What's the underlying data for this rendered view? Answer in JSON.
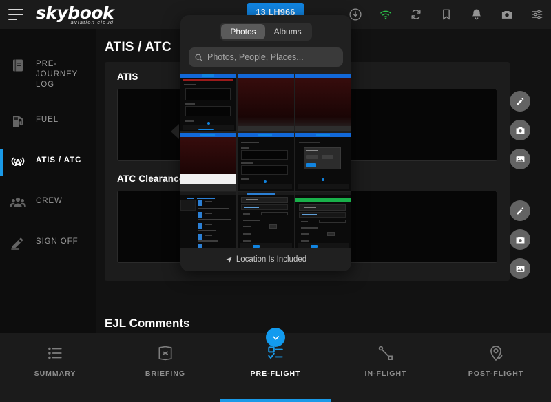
{
  "app": {
    "brand_name": "skybook",
    "brand_tagline": "aviation cloud",
    "flight_chip": "13 LH966"
  },
  "topbar": {
    "icons": [
      {
        "name": "menu-icon",
        "label": "Menu"
      },
      {
        "name": "download-icon",
        "label": "Download"
      },
      {
        "name": "wifi-icon",
        "label": "Connected",
        "color": "#2cc14a"
      },
      {
        "name": "sync-icon",
        "label": "Sync"
      },
      {
        "name": "bookmark-icon",
        "label": "Bookmark"
      },
      {
        "name": "bell-icon",
        "label": "Notifications"
      },
      {
        "name": "camera-icon",
        "label": "Camera"
      },
      {
        "name": "settings-sliders-icon",
        "label": "Settings"
      }
    ]
  },
  "sidebar": {
    "items": [
      {
        "label": "PRE-JOURNEY LOG",
        "icon": "book-icon",
        "active": false
      },
      {
        "label": "FUEL",
        "icon": "fuel-pump-icon",
        "active": false
      },
      {
        "label": "ATIS / ATC",
        "icon": "antenna-icon",
        "active": true
      },
      {
        "label": "CREW",
        "icon": "crew-people-icon",
        "active": false
      },
      {
        "label": "SIGN OFF",
        "icon": "sign-off-pen-icon",
        "active": false
      }
    ]
  },
  "main": {
    "page_title": "ATIS / ATC",
    "sections": [
      {
        "title": "ATIS",
        "value": ""
      },
      {
        "title": "ATC Clearance",
        "value": ""
      }
    ],
    "ejl_title": "EJL Comments",
    "action_buttons": [
      {
        "name": "edit-button",
        "icon": "pencil-icon"
      },
      {
        "name": "camera-button",
        "icon": "camera-icon"
      },
      {
        "name": "gallery-button",
        "icon": "image-icon"
      }
    ],
    "scroll_down_label": "Scroll down"
  },
  "photo_popover": {
    "tabs": [
      {
        "label": "Photos",
        "selected": true
      },
      {
        "label": "Albums",
        "selected": false
      }
    ],
    "search": {
      "placeholder": "Photos, People, Places...",
      "value": ""
    },
    "footer": "Location Is Included",
    "thumbnails": [
      {
        "name": "thumb-journey-log-form",
        "kind": "form-dark"
      },
      {
        "name": "thumb-dark-red-photo-1",
        "kind": "photo-red"
      },
      {
        "name": "thumb-dark-red-photo-2",
        "kind": "photo-red"
      },
      {
        "name": "thumb-dark-red-photo-3",
        "kind": "photo-red-white"
      },
      {
        "name": "thumb-atis-form",
        "kind": "form-dark"
      },
      {
        "name": "thumb-image-options-dialog",
        "kind": "dialog"
      },
      {
        "name": "thumb-file-list",
        "kind": "file-list"
      },
      {
        "name": "thumb-journey-log-blue",
        "kind": "journey-blue"
      },
      {
        "name": "thumb-journey-log-green",
        "kind": "journey-green"
      }
    ]
  },
  "bottom_nav": {
    "items": [
      {
        "label": "SUMMARY",
        "icon": "list-icon",
        "active": false
      },
      {
        "label": "BRIEFING",
        "icon": "briefing-doc-icon",
        "active": false
      },
      {
        "label": "PRE-FLIGHT",
        "icon": "checklist-icon",
        "active": true
      },
      {
        "label": "IN-FLIGHT",
        "icon": "route-icon",
        "active": false
      },
      {
        "label": "POST-FLIGHT",
        "icon": "pin-check-icon",
        "active": false
      }
    ]
  },
  "colors": {
    "accent": "#1a9ae8",
    "chip_blue": "#1184e0",
    "wifi_green": "#2cc14a",
    "bg": "#121212",
    "panel": "#1c1c1c"
  }
}
